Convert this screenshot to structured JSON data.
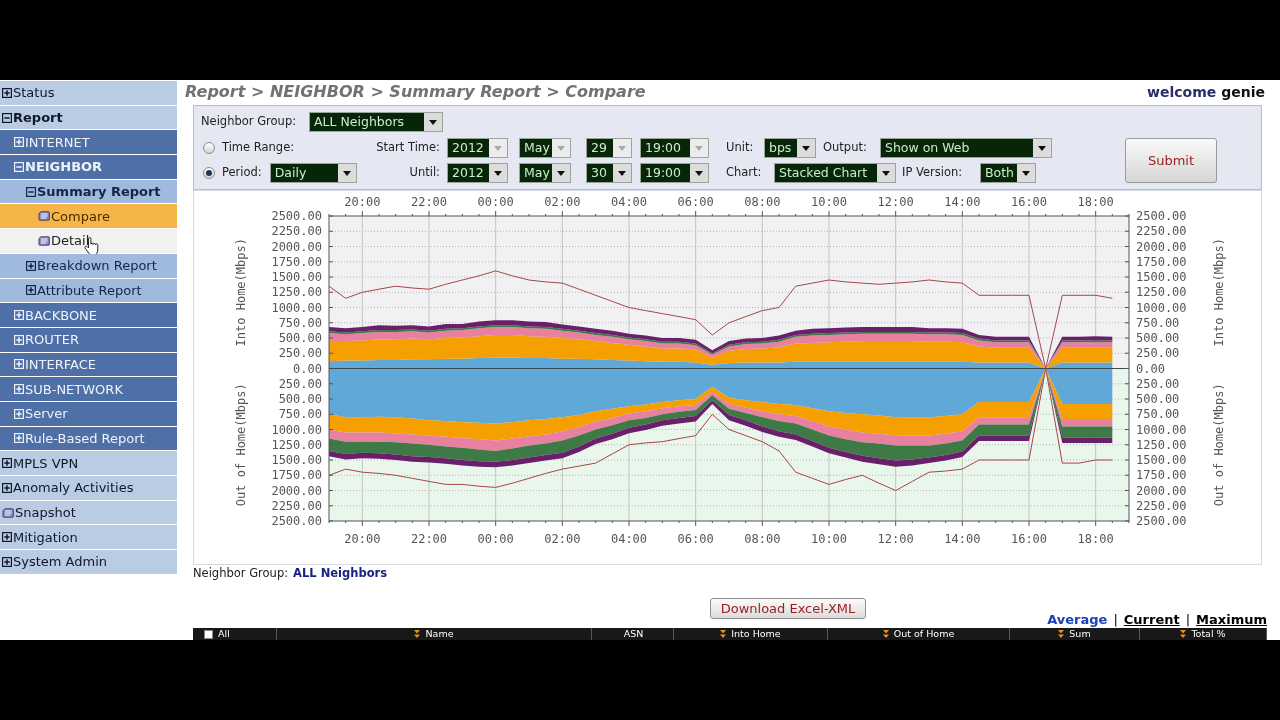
{
  "header": {
    "breadcrumb": "Report > NEIGHBOR > Summary Report > Compare",
    "greeting": "welcome",
    "user": "genie"
  },
  "sidebar": {
    "items": [
      {
        "label": "Status",
        "kind": "folder",
        "expanded": false,
        "selected": false,
        "hovered": false
      },
      {
        "label": "Report",
        "kind": "folder",
        "expanded": true,
        "selected": false,
        "hovered": false,
        "children": [
          {
            "label": "INTERNET",
            "kind": "folder",
            "expanded": false,
            "selected": false,
            "hovered": false
          },
          {
            "label": "NEIGHBOR",
            "kind": "folder",
            "expanded": true,
            "selected": false,
            "hovered": false,
            "children": [
              {
                "label": "Summary Report",
                "kind": "folder",
                "expanded": true,
                "selected": false,
                "hovered": false,
                "children": [
                  {
                    "label": "Compare",
                    "kind": "page",
                    "selected": true,
                    "hovered": false
                  },
                  {
                    "label": "Detail",
                    "kind": "page",
                    "selected": false,
                    "hovered": true
                  }
                ]
              },
              {
                "label": "Breakdown Report",
                "kind": "folder",
                "expanded": false,
                "selected": false,
                "hovered": false
              },
              {
                "label": "Attribute Report",
                "kind": "folder",
                "expanded": false,
                "selected": false,
                "hovered": false
              }
            ]
          },
          {
            "label": "BACKBONE",
            "kind": "folder",
            "expanded": false,
            "selected": false,
            "hovered": false
          },
          {
            "label": "ROUTER",
            "kind": "folder",
            "expanded": false,
            "selected": false,
            "hovered": false
          },
          {
            "label": "INTERFACE",
            "kind": "folder",
            "expanded": false,
            "selected": false,
            "hovered": false
          },
          {
            "label": "SUB-NETWORK",
            "kind": "folder",
            "expanded": false,
            "selected": false,
            "hovered": false
          },
          {
            "label": "Server",
            "kind": "folder",
            "expanded": false,
            "selected": false,
            "hovered": false
          },
          {
            "label": "Rule-Based Report",
            "kind": "folder",
            "expanded": false,
            "selected": false,
            "hovered": false
          }
        ]
      },
      {
        "label": "MPLS VPN",
        "kind": "folder",
        "expanded": false,
        "selected": false,
        "hovered": false
      },
      {
        "label": "Anomaly Activities",
        "kind": "folder",
        "expanded": false,
        "selected": false,
        "hovered": false
      },
      {
        "label": "Snapshot",
        "kind": "page",
        "selected": false,
        "hovered": false
      },
      {
        "label": "Mitigation",
        "kind": "folder",
        "expanded": false,
        "selected": false,
        "hovered": false
      },
      {
        "label": "System Admin",
        "kind": "folder",
        "expanded": false,
        "selected": false,
        "hovered": false
      }
    ]
  },
  "filters": {
    "neighbor_group": {
      "label": "Neighbor Group:",
      "value": "ALL Neighbors"
    },
    "range_modes": [
      {
        "label": "Time Range:",
        "selected": false
      },
      {
        "label": "Period:",
        "selected": true
      }
    ],
    "period": {
      "value": "Daily"
    },
    "start_time": {
      "label": "Start Time:",
      "disabled": true,
      "fields": [
        "2012",
        "May",
        "29",
        "19:00"
      ]
    },
    "until": {
      "label": "Until:",
      "disabled": false,
      "fields": [
        "2012",
        "May",
        "30",
        "19:00"
      ]
    },
    "unit": {
      "label": "Unit:",
      "value": "bps"
    },
    "output": {
      "label": "Output:",
      "value": "Show on Web"
    },
    "chart": {
      "label": "Chart:",
      "value": "Stacked Chart"
    },
    "ip_version": {
      "label": "IP Version:",
      "value": "Both"
    },
    "submit": "Submit"
  },
  "chart": {
    "into_home": {
      "axis_title": "Into Home(Mbps)",
      "chart_data": {
        "type": "area",
        "stacked": true,
        "grid": true,
        "ylim": [
          0,
          2500
        ],
        "categories": [
          null,
          null,
          "20:00",
          null,
          null,
          null,
          "22:00",
          null,
          null,
          null,
          "00:00",
          null,
          null,
          null,
          "02:00",
          null,
          null,
          null,
          "04:00",
          null,
          null,
          null,
          "06:00",
          null,
          null,
          null,
          "08:00",
          null,
          null,
          null,
          "10:00",
          null,
          null,
          null,
          "12:00",
          null,
          null,
          null,
          "14:00",
          null,
          null,
          null,
          "16:00",
          null,
          null,
          null,
          "18:00",
          null,
          null
        ],
        "yticks": [
          {
            "value": 2500,
            "label": "2500.00"
          },
          {
            "value": 2250,
            "label": "2250.00"
          },
          {
            "value": 2000,
            "label": "2000.00"
          },
          {
            "value": 1750,
            "label": "1750.00"
          },
          {
            "value": 1500,
            "label": "1500.00"
          },
          {
            "value": 1250,
            "label": "1250.00"
          },
          {
            "value": 1000,
            "label": "1000.00"
          },
          {
            "value": 750,
            "label": "750.00"
          },
          {
            "value": 500,
            "label": "500.00"
          },
          {
            "value": 250,
            "label": "250.00"
          },
          {
            "value": 0,
            "label": "0.00"
          }
        ],
        "series": [
          {
            "color": "#5fa8d8",
            "values": [
              120,
              130,
              130,
              140,
              140,
              150,
              150,
              160,
              160,
              170,
              180,
              180,
              170,
              170,
              160,
              160,
              150,
              140,
              130,
              120,
              110,
              110,
              100,
              60,
              90,
              100,
              100,
              100,
              110,
              110,
              110,
              110,
              110,
              110,
              110,
              110,
              110,
              110,
              110,
              100,
              100,
              100,
              100,
              0,
              100,
              100,
              100,
              100,
              null
            ]
          },
          {
            "color": "#f5a000",
            "values": [
              330,
              320,
              330,
              340,
              340,
              340,
              330,
              340,
              350,
              360,
              370,
              370,
              360,
              350,
              340,
              320,
              300,
              280,
              260,
              240,
              220,
              220,
              210,
              120,
              200,
              220,
              230,
              250,
              300,
              310,
              320,
              330,
              340,
              340,
              340,
              340,
              330,
              330,
              320,
              260,
              240,
              240,
              240,
              0,
              240,
              240,
              240,
              240,
              null
            ]
          },
          {
            "color": "#e8809f",
            "values": [
              130,
              110,
              120,
              120,
              120,
              120,
              110,
              120,
              120,
              130,
              130,
              130,
              130,
              130,
              120,
              110,
              100,
              100,
              90,
              90,
              80,
              80,
              70,
              50,
              70,
              80,
              80,
              90,
              110,
              120,
              120,
              120,
              120,
              120,
              120,
              120,
              120,
              120,
              120,
              100,
              90,
              90,
              90,
              0,
              90,
              90,
              90,
              90,
              null
            ]
          },
          {
            "color": "#3d7a45",
            "values": [
              30,
              30,
              30,
              30,
              30,
              30,
              30,
              30,
              30,
              30,
              30,
              30,
              30,
              30,
              30,
              30,
              30,
              30,
              30,
              30,
              30,
              30,
              30,
              20,
              30,
              30,
              30,
              30,
              30,
              30,
              30,
              30,
              30,
              30,
              30,
              30,
              30,
              30,
              30,
              30,
              30,
              30,
              30,
              0,
              30,
              30,
              30,
              30,
              null
            ]
          },
          {
            "color": "#6a1f6a",
            "values": [
              70,
              70,
              70,
              80,
              70,
              70,
              70,
              80,
              70,
              80,
              80,
              80,
              80,
              80,
              70,
              70,
              70,
              70,
              60,
              60,
              60,
              60,
              60,
              50,
              60,
              60,
              60,
              70,
              70,
              80,
              80,
              80,
              80,
              80,
              80,
              80,
              70,
              70,
              70,
              60,
              60,
              60,
              60,
              0,
              60,
              60,
              70,
              60,
              null
            ]
          }
        ]
      }
    },
    "out_of_home": {
      "axis_title": "Out of Home(Mbps)",
      "chart_data": {
        "type": "area",
        "stacked": true,
        "grid": true,
        "ylim": [
          -2500,
          0
        ],
        "categories": [
          null,
          null,
          "20:00",
          null,
          null,
          null,
          "22:00",
          null,
          null,
          null,
          "00:00",
          null,
          null,
          null,
          "02:00",
          null,
          null,
          null,
          "04:00",
          null,
          null,
          null,
          "06:00",
          null,
          null,
          null,
          "08:00",
          null,
          null,
          null,
          "10:00",
          null,
          null,
          null,
          "12:00",
          null,
          null,
          null,
          "14:00",
          null,
          null,
          null,
          "16:00",
          null,
          null,
          null,
          "18:00",
          null,
          null
        ],
        "yticks": [
          {
            "value": -250,
            "label": "250.00"
          },
          {
            "value": -500,
            "label": "500.00"
          },
          {
            "value": -750,
            "label": "750.00"
          },
          {
            "value": -1000,
            "label": "1000.00"
          },
          {
            "value": -1250,
            "label": "1250.00"
          },
          {
            "value": -1500,
            "label": "1500.00"
          },
          {
            "value": -1750,
            "label": "1750.00"
          },
          {
            "value": -2000,
            "label": "2000.00"
          },
          {
            "value": -2250,
            "label": "2250.00"
          },
          {
            "value": -2500,
            "label": "2500.00"
          }
        ],
        "series": [
          {
            "color": "#5fa8d8",
            "values": [
              -750,
              -800,
              -800,
              -790,
              -800,
              -820,
              -850,
              -860,
              -880,
              -890,
              -900,
              -880,
              -850,
              -830,
              -800,
              -760,
              -700,
              -660,
              -620,
              -590,
              -550,
              -520,
              -500,
              -300,
              -480,
              -520,
              -550,
              -580,
              -600,
              -650,
              -700,
              -730,
              -750,
              -770,
              -800,
              -800,
              -800,
              -780,
              -750,
              -550,
              -550,
              -550,
              -550,
              0,
              -580,
              -580,
              -580,
              -580,
              null
            ]
          },
          {
            "color": "#f5a000",
            "values": [
              -250,
              -250,
              -250,
              -260,
              -260,
              -260,
              -250,
              -260,
              -260,
              -270,
              -280,
              -270,
              -260,
              -250,
              -230,
              -200,
              -170,
              -150,
              -120,
              -110,
              -100,
              -100,
              -100,
              -80,
              -100,
              -120,
              -150,
              -170,
              -180,
              -210,
              -250,
              -270,
              -300,
              -300,
              -300,
              -300,
              -300,
              -290,
              -280,
              -250,
              -250,
              -250,
              -250,
              0,
              -250,
              -250,
              -250,
              -250,
              null
            ]
          },
          {
            "color": "#e8809f",
            "values": [
              -150,
              -150,
              -150,
              -150,
              -150,
              -150,
              -150,
              -160,
              -160,
              -170,
              -170,
              -160,
              -150,
              -150,
              -150,
              -140,
              -130,
              -120,
              -110,
              -110,
              -100,
              -90,
              -80,
              -60,
              -80,
              -90,
              -100,
              -110,
              -120,
              -140,
              -150,
              -160,
              -160,
              -160,
              -160,
              -160,
              -160,
              -160,
              -150,
              -120,
              -120,
              -120,
              -120,
              0,
              -120,
              -120,
              -120,
              -120,
              null
            ]
          },
          {
            "color": "#3d7a45",
            "values": [
              -200,
              -200,
              -180,
              -190,
              -200,
              -210,
              -200,
              -190,
              -200,
              -190,
              -180,
              -190,
              -200,
              -190,
              -200,
              -180,
              -150,
              -140,
              -120,
              -110,
              -100,
              -100,
              -100,
              -80,
              -100,
              -120,
              -150,
              -170,
              -180,
              -190,
              -200,
              -210,
              -220,
              -240,
              -250,
              -230,
              -200,
              -190,
              -180,
              -180,
              -180,
              -180,
              -180,
              0,
              -180,
              -180,
              -180,
              -180,
              null
            ]
          },
          {
            "color": "#6a1f6a",
            "values": [
              -90,
              -90,
              -90,
              -90,
              -90,
              -90,
              -90,
              -90,
              -90,
              -90,
              -90,
              -90,
              -90,
              -90,
              -90,
              -90,
              -90,
              -90,
              -90,
              -90,
              -90,
              -90,
              -90,
              -60,
              -90,
              -90,
              -90,
              -90,
              -90,
              -90,
              -90,
              -90,
              -100,
              -100,
              -100,
              -100,
              -90,
              -90,
              -90,
              -90,
              -90,
              -90,
              -90,
              0,
              -90,
              -90,
              -90,
              -90,
              null
            ]
          }
        ]
      }
    },
    "peak_lines": {
      "axis_titles": [
        "Into Home(Mbps)",
        "Out of Home(Mbps)"
      ],
      "chart_data": {
        "type": "line",
        "ylim": [
          -2500,
          2500
        ],
        "categories": [
          null,
          null,
          null,
          null,
          null,
          null,
          null,
          null,
          null,
          null,
          null,
          null,
          null,
          null,
          null,
          null,
          null,
          null,
          null,
          null,
          null,
          null,
          null,
          null,
          null,
          null,
          null,
          null,
          null,
          null,
          null,
          null,
          null,
          null,
          null,
          null,
          null,
          null,
          null,
          null,
          null,
          null,
          null,
          null,
          null,
          null,
          null,
          null,
          null
        ],
        "yticks": [
          {
            "value": 2500,
            "label": "2500.00"
          },
          {
            "value": 2250,
            "label": "2250.00"
          },
          {
            "value": 2000,
            "label": "2000.00"
          },
          {
            "value": 1750,
            "label": "1750.00"
          },
          {
            "value": 1500,
            "label": "1500.00"
          },
          {
            "value": 1250,
            "label": "1250.00"
          },
          {
            "value": 1000,
            "label": "1000.00"
          },
          {
            "value": 750,
            "label": "750.00"
          },
          {
            "value": 500,
            "label": "500.00"
          },
          {
            "value": 250,
            "label": "250.00"
          },
          {
            "value": 0,
            "label": "0.00"
          },
          {
            "value": -250,
            "label": "250.00"
          },
          {
            "value": -500,
            "label": "500.00"
          },
          {
            "value": -750,
            "label": "750.00"
          },
          {
            "value": -1000,
            "label": "1000.00"
          },
          {
            "value": -1250,
            "label": "1250.00"
          },
          {
            "value": -1500,
            "label": "1500.00"
          },
          {
            "value": -1750,
            "label": "1750.00"
          },
          {
            "value": -2000,
            "label": "2000.00"
          },
          {
            "value": -2250,
            "label": "2250.00"
          },
          {
            "value": -2500,
            "label": "2500.00"
          }
        ],
        "series": [
          {
            "color": "#a84545",
            "values": [
              1350,
              1150,
              1250,
              1300,
              1350,
              1320,
              1300,
              1380,
              1450,
              1520,
              1600,
              1520,
              1450,
              1420,
              1400,
              1300,
              1200,
              1100,
              1000,
              950,
              900,
              850,
              800,
              550,
              750,
              850,
              950,
              1000,
              1350,
              1400,
              1450,
              1420,
              1400,
              1380,
              1400,
              1420,
              1450,
              1420,
              1400,
              1200,
              1200,
              1200,
              1200,
              0,
              1200,
              1200,
              1200,
              1150,
              null
            ]
          },
          {
            "color": "#a84545",
            "values": [
              -1750,
              -1650,
              -1700,
              -1720,
              -1750,
              -1800,
              -1850,
              -1900,
              -1900,
              -1930,
              -1950,
              -1880,
              -1800,
              -1720,
              -1650,
              -1600,
              -1550,
              -1400,
              -1250,
              -1220,
              -1200,
              -1150,
              -1100,
              -750,
              -1000,
              -1100,
              -1200,
              -1350,
              -1700,
              -1800,
              -1900,
              -1820,
              -1750,
              -1880,
              -2000,
              -1850,
              -1700,
              -1680,
              -1650,
              -1500,
              -1500,
              -1500,
              -1500,
              0,
              -1550,
              -1550,
              -1500,
              -1500,
              null
            ]
          }
        ]
      }
    }
  },
  "summary": {
    "label": "Neighbor Group:",
    "value": "ALL Neighbors"
  },
  "download_button": "Download Excel-XML",
  "stat_modes": [
    {
      "label": "Average",
      "selected": true
    },
    {
      "label": "Current",
      "selected": false
    },
    {
      "label": "Maximum",
      "selected": false
    }
  ],
  "stat_separators": [
    "|",
    "|"
  ],
  "table": {
    "columns": [
      {
        "label": "All",
        "kind": "check",
        "checked": false
      },
      {
        "label": "Name",
        "kind": "sort"
      },
      {
        "label": "ASN",
        "kind": "plain"
      },
      {
        "label": "Into Home",
        "kind": "sort"
      },
      {
        "label": "Out of Home",
        "kind": "sort"
      },
      {
        "label": "Sum",
        "kind": "sort"
      },
      {
        "label": "Total %",
        "kind": "sort"
      }
    ]
  }
}
